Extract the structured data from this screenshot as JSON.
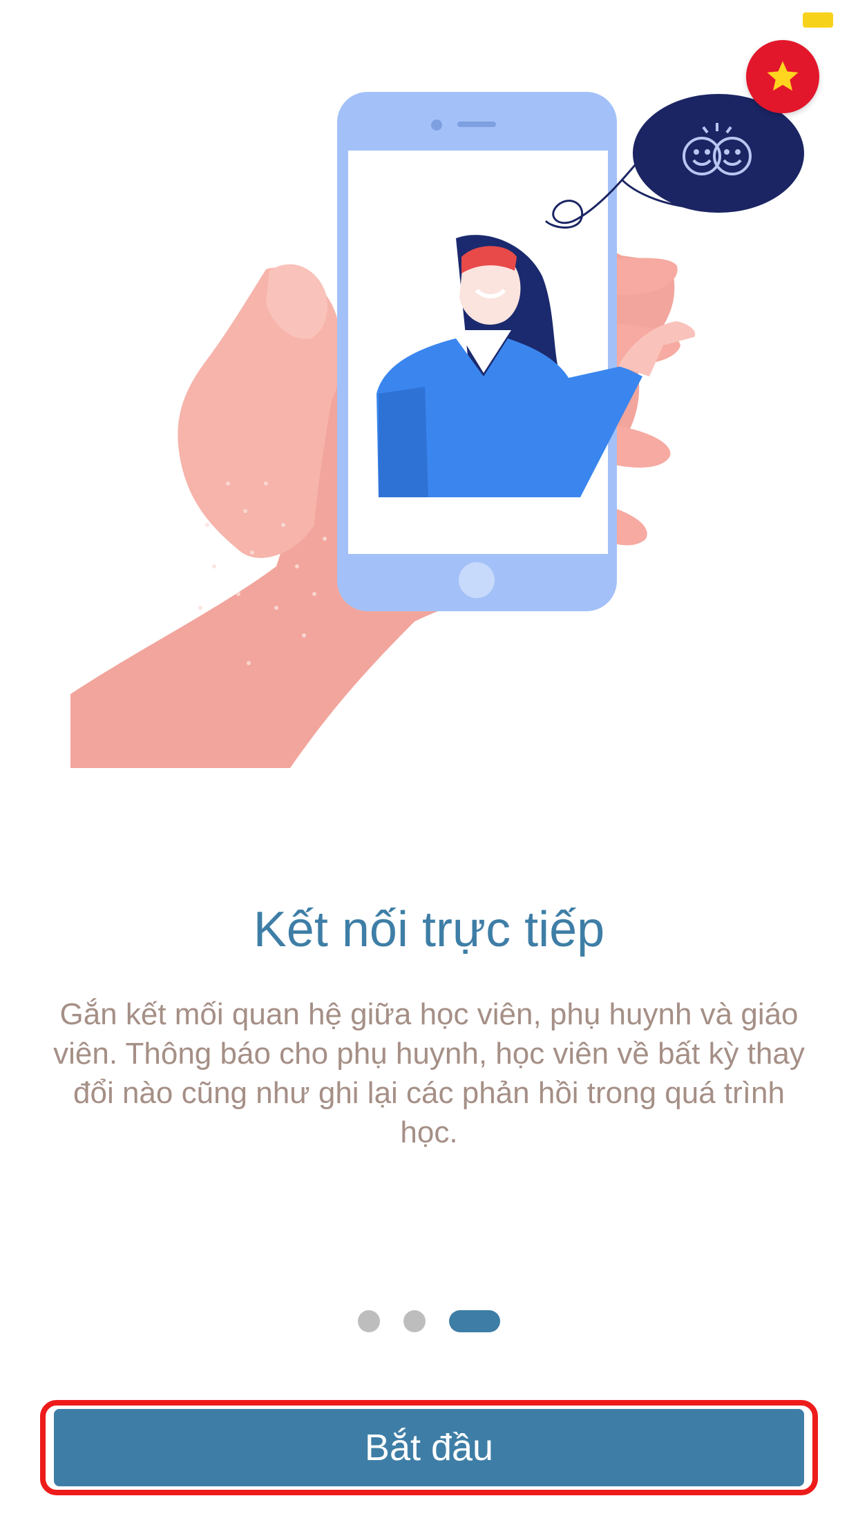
{
  "onboarding": {
    "title": "Kết nối trực tiếp",
    "description": "Gắn kết mối quan hệ giữa học viên, phụ huynh và giáo viên. Thông báo cho phụ huynh, học viên về bất kỳ thay đổi nào cũng như ghi lại các phản hồi trong quá trình học.",
    "page_count": 3,
    "current_page": 3,
    "start_label": "Bắt đầu"
  },
  "icons": {
    "language": "vietnam-flag-icon",
    "bubble": "smiling-faces-icon"
  },
  "colors": {
    "accent": "#3e7ea6",
    "description_text": "#a58f86",
    "dot_inactive": "#bdbdbd",
    "highlight": "#ee1b1b",
    "flag_red": "#e3172b",
    "flag_star": "#ffd51f"
  }
}
